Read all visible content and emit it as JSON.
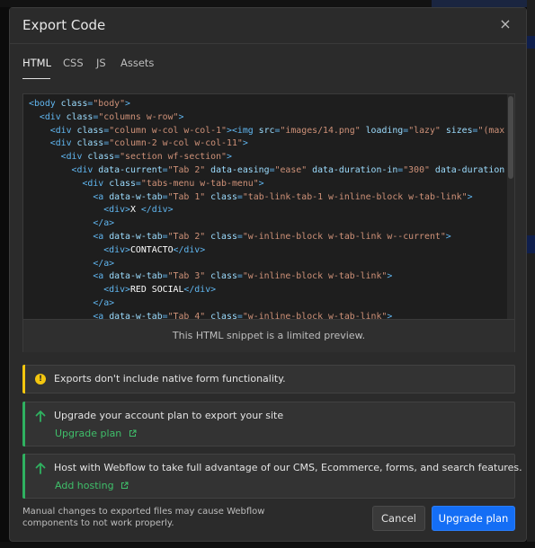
{
  "modal": {
    "title": "Export Code",
    "close_label": "×"
  },
  "tabs": [
    {
      "label": "HTML",
      "active": true
    },
    {
      "label": "CSS",
      "active": false
    },
    {
      "label": "JS",
      "active": false
    },
    {
      "label": "Assets",
      "active": false
    }
  ],
  "code": {
    "lines": [
      [
        [
          "t",
          "<body "
        ],
        [
          "a",
          "class"
        ],
        [
          "t",
          "="
        ],
        [
          "v",
          "\"body\""
        ],
        [
          "t",
          ">"
        ]
      ],
      [
        [
          "t",
          "  <div "
        ],
        [
          "a",
          "class"
        ],
        [
          "t",
          "="
        ],
        [
          "v",
          "\"columns w-row\""
        ],
        [
          "t",
          ">"
        ]
      ],
      [
        [
          "t",
          "    <div "
        ],
        [
          "a",
          "class"
        ],
        [
          "t",
          "="
        ],
        [
          "v",
          "\"column w-col w-col-1\""
        ],
        [
          "t",
          "><img "
        ],
        [
          "a",
          "src"
        ],
        [
          "t",
          "="
        ],
        [
          "v",
          "\"images/14.png\""
        ],
        [
          "t",
          " "
        ],
        [
          "a",
          "loading"
        ],
        [
          "t",
          "="
        ],
        [
          "v",
          "\"lazy\""
        ],
        [
          "t",
          " "
        ],
        [
          "a",
          "sizes"
        ],
        [
          "t",
          "="
        ],
        [
          "v",
          "\"(max-"
        ]
      ],
      [
        [
          "t",
          "    <div "
        ],
        [
          "a",
          "class"
        ],
        [
          "t",
          "="
        ],
        [
          "v",
          "\"column-2 w-col w-col-11\""
        ],
        [
          "t",
          ">"
        ]
      ],
      [
        [
          "t",
          "      <div "
        ],
        [
          "a",
          "class"
        ],
        [
          "t",
          "="
        ],
        [
          "v",
          "\"section wf-section\""
        ],
        [
          "t",
          ">"
        ]
      ],
      [
        [
          "t",
          "        <div "
        ],
        [
          "a",
          "data-current"
        ],
        [
          "t",
          "="
        ],
        [
          "v",
          "\"Tab 2\""
        ],
        [
          "t",
          " "
        ],
        [
          "a",
          "data-easing"
        ],
        [
          "t",
          "="
        ],
        [
          "v",
          "\"ease\""
        ],
        [
          "t",
          " "
        ],
        [
          "a",
          "data-duration-in"
        ],
        [
          "t",
          "="
        ],
        [
          "v",
          "\"300\""
        ],
        [
          "t",
          " "
        ],
        [
          "a",
          "data-duration-"
        ]
      ],
      [
        [
          "t",
          "          <div "
        ],
        [
          "a",
          "class"
        ],
        [
          "t",
          "="
        ],
        [
          "v",
          "\"tabs-menu w-tab-menu\""
        ],
        [
          "t",
          ">"
        ]
      ],
      [
        [
          "t",
          "            <a "
        ],
        [
          "a",
          "data-w-tab"
        ],
        [
          "t",
          "="
        ],
        [
          "v",
          "\"Tab 1\""
        ],
        [
          "t",
          " "
        ],
        [
          "a",
          "class"
        ],
        [
          "t",
          "="
        ],
        [
          "v",
          "\"tab-link-tab-1 w-inline-block w-tab-link\""
        ],
        [
          "t",
          ">"
        ]
      ],
      [
        [
          "t",
          "              <div>"
        ],
        [
          "x",
          "X "
        ],
        [
          "t",
          "</div>"
        ]
      ],
      [
        [
          "t",
          "            </a>"
        ]
      ],
      [
        [
          "t",
          "            <a "
        ],
        [
          "a",
          "data-w-tab"
        ],
        [
          "t",
          "="
        ],
        [
          "v",
          "\"Tab 2\""
        ],
        [
          "t",
          " "
        ],
        [
          "a",
          "class"
        ],
        [
          "t",
          "="
        ],
        [
          "v",
          "\"w-inline-block w-tab-link w--current\""
        ],
        [
          "t",
          ">"
        ]
      ],
      [
        [
          "t",
          "              <div>"
        ],
        [
          "x",
          "CONTACTO"
        ],
        [
          "t",
          "</div>"
        ]
      ],
      [
        [
          "t",
          "            </a>"
        ]
      ],
      [
        [
          "t",
          "            <a "
        ],
        [
          "a",
          "data-w-tab"
        ],
        [
          "t",
          "="
        ],
        [
          "v",
          "\"Tab 3\""
        ],
        [
          "t",
          " "
        ],
        [
          "a",
          "class"
        ],
        [
          "t",
          "="
        ],
        [
          "v",
          "\"w-inline-block w-tab-link\""
        ],
        [
          "t",
          ">"
        ]
      ],
      [
        [
          "t",
          "              <div>"
        ],
        [
          "x",
          "RED SOCIAL"
        ],
        [
          "t",
          "</div>"
        ]
      ],
      [
        [
          "t",
          "            </a>"
        ]
      ],
      [
        [
          "t",
          "            <a "
        ],
        [
          "a",
          "data-w-tab"
        ],
        [
          "t",
          "="
        ],
        [
          "v",
          "\"Tab 4\""
        ],
        [
          "t",
          " "
        ],
        [
          "a",
          "class"
        ],
        [
          "t",
          "="
        ],
        [
          "v",
          "\"w-inline-block w-tab-link\""
        ],
        [
          "t",
          ">"
        ]
      ]
    ],
    "preview_note": "This HTML snippet is a limited preview."
  },
  "notices": {
    "forms": {
      "text": "Exports don't include native form functionality.",
      "icon": "warning-icon",
      "color": "#f3c60f"
    },
    "upgrade": {
      "text": "Upgrade your account plan to export your site",
      "link": "Upgrade plan",
      "icon": "arrow-up-icon",
      "color": "#2fb160"
    },
    "hosting": {
      "text": "Host with Webflow to take full advantage of our CMS, Ecommerce, forms, and search features.",
      "link": "Add hosting",
      "icon": "arrow-up-icon",
      "color": "#2fb160"
    }
  },
  "footer": {
    "note": "Manual changes to exported files may cause Webflow components to not work properly.",
    "cancel_label": "Cancel",
    "upgrade_label": "Upgrade plan"
  },
  "colors": {
    "accent": "#146ef5",
    "success": "#2fb160",
    "warning": "#f3c60f"
  }
}
